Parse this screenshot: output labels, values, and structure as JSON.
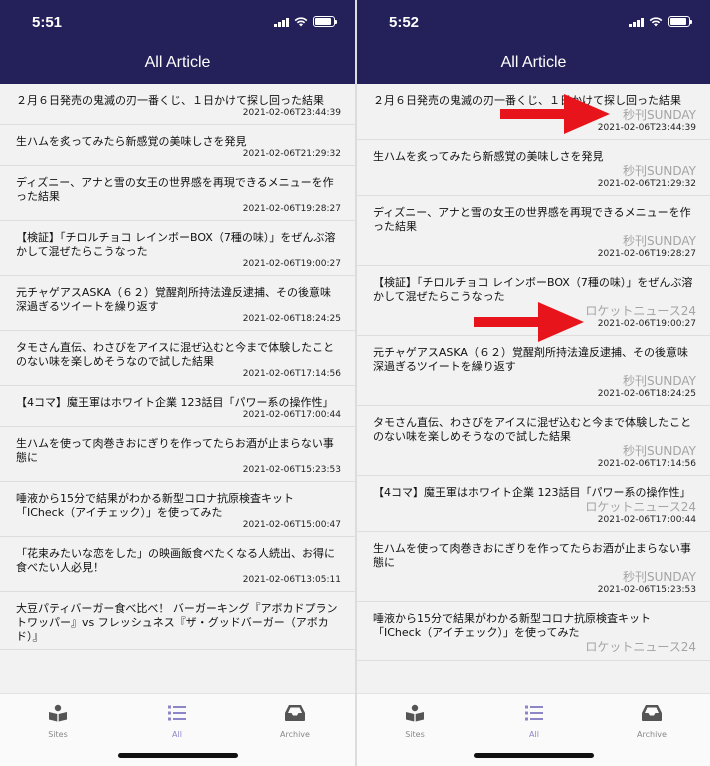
{
  "left": {
    "status_time": "5:51",
    "title": "All Article",
    "articles": [
      {
        "title": "２月６日発売の鬼滅の刃一番くじ、１日かけて探し回った結果",
        "date": "2021-02-06T23:44:39"
      },
      {
        "title": "生ハムを炙ってみたら新感覚の美味しさを発見",
        "date": "2021-02-06T21:29:32"
      },
      {
        "title": "ディズニー、アナと雪の女王の世界感を再現できるメニューを作った結果",
        "date": "2021-02-06T19:28:27"
      },
      {
        "title": "【検証】「チロルチョコ レインボーBOX（7種の味）」をぜんぶ溶かして混ぜたらこうなった",
        "date": "2021-02-06T19:00:27"
      },
      {
        "title": "元チャゲアスASKA（６２）覚醒剤所持法違反逮捕、その後意味深過ぎるツイートを繰り返す",
        "date": "2021-02-06T18:24:25"
      },
      {
        "title": "タモさん直伝、わさびをアイスに混ぜ込むと今まで体験したことのない味を楽しめそうなので試した結果",
        "date": "2021-02-06T17:14:56"
      },
      {
        "title": "【4コマ】魔王軍はホワイト企業 123話目「パワー系の操作性」",
        "date": "2021-02-06T17:00:44"
      },
      {
        "title": "生ハムを使って肉巻きおにぎりを作ってたらお酒が止まらない事態に",
        "date": "2021-02-06T15:23:53"
      },
      {
        "title": "唾液から15分で結果がわかる新型コロナ抗原検査キット「ICheck（アイチェック）」を使ってみた",
        "date": "2021-02-06T15:00:47"
      },
      {
        "title": "「花束みたいな恋をした」の映画飯食べたくなる人続出、お得に食べたい人必見！",
        "date": "2021-02-06T13:05:11"
      },
      {
        "title": "大豆パティバーガー食べ比べ！ バーガーキング『アボカドプラントワッパー』vs フレッシュネス『ザ・グッドバーガー（アボカド）』",
        "date": ""
      }
    ],
    "tabs": [
      {
        "label": "Sites",
        "icon": "book-reader-icon"
      },
      {
        "label": "All",
        "icon": "list-icon"
      },
      {
        "label": "Archive",
        "icon": "inbox-icon"
      }
    ]
  },
  "right": {
    "status_time": "5:52",
    "title": "All Article",
    "articles": [
      {
        "title": "２月６日発売の鬼滅の刃一番くじ、１日かけて探し回った結果",
        "source": "秒刊SUNDAY",
        "date": "2021-02-06T23:44:39"
      },
      {
        "title": "生ハムを炙ってみたら新感覚の美味しさを発見",
        "source": "秒刊SUNDAY",
        "date": "2021-02-06T21:29:32"
      },
      {
        "title": "ディズニー、アナと雪の女王の世界感を再現できるメニューを作った結果",
        "source": "秒刊SUNDAY",
        "date": "2021-02-06T19:28:27"
      },
      {
        "title": "【検証】「チロルチョコ レインボーBOX（7種の味）」をぜんぶ溶かして混ぜたらこうなった",
        "source": "ロケットニュース24",
        "date": "2021-02-06T19:00:27"
      },
      {
        "title": "元チャゲアスASKA（６２）覚醒剤所持法違反逮捕、その後意味深過ぎるツイートを繰り返す",
        "source": "秒刊SUNDAY",
        "date": "2021-02-06T18:24:25"
      },
      {
        "title": "タモさん直伝、わさびをアイスに混ぜ込むと今まで体験したことのない味を楽しめそうなので試した結果",
        "source": "秒刊SUNDAY",
        "date": "2021-02-06T17:14:56"
      },
      {
        "title": "【4コマ】魔王軍はホワイト企業 123話目「パワー系の操作性」",
        "source": "ロケットニュース24",
        "date": "2021-02-06T17:00:44"
      },
      {
        "title": "生ハムを使って肉巻きおにぎりを作ってたらお酒が止まらない事態に",
        "source": "秒刊SUNDAY",
        "date": "2021-02-06T15:23:53"
      },
      {
        "title": "唾液から15分で結果がわかる新型コロナ抗原検査キット「ICheck（アイチェック）」を使ってみた",
        "source": "ロケットニュース24",
        "date": ""
      }
    ],
    "tabs": [
      {
        "label": "Sites",
        "icon": "book-reader-icon"
      },
      {
        "label": "All",
        "icon": "list-icon"
      },
      {
        "label": "Archive",
        "icon": "inbox-icon"
      }
    ],
    "annotation_color": "#e8141b"
  },
  "colors": {
    "header": "#24205a",
    "active_tab": "#8c86c9",
    "inactive_tab": "#8a8a8a"
  }
}
